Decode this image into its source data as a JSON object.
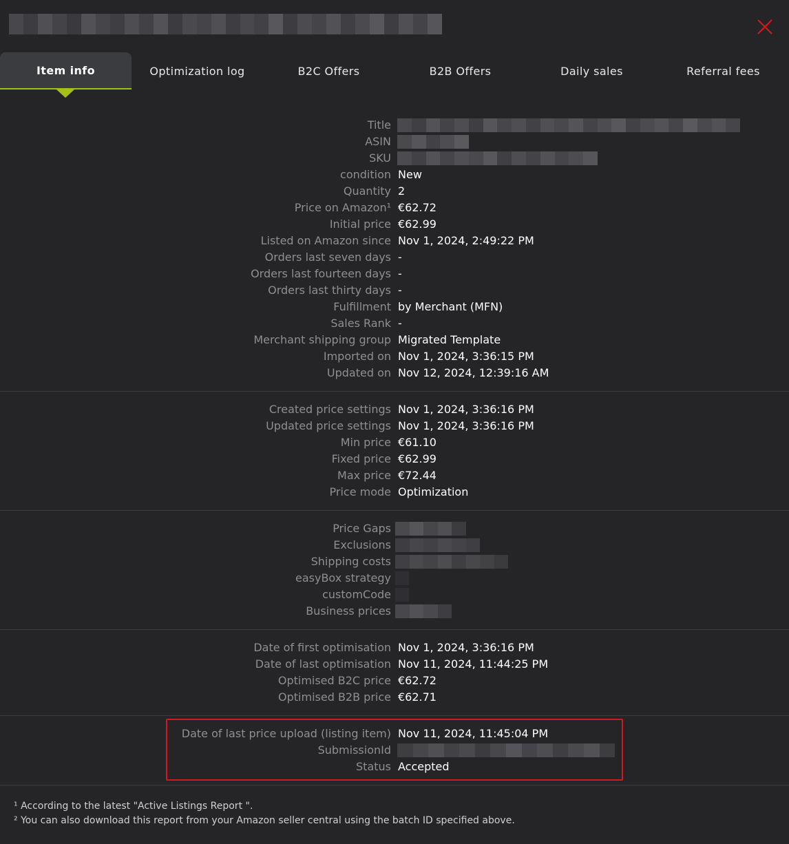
{
  "tabs": [
    {
      "label": "Item info",
      "active": true
    },
    {
      "label": "Optimization log"
    },
    {
      "label": "B2C Offers"
    },
    {
      "label": "B2B Offers"
    },
    {
      "label": "Daily sales"
    },
    {
      "label": "Referral fees"
    }
  ],
  "close_icon": "close-icon",
  "accent_color": "#a3c11b",
  "highlight_color": "#d6171e",
  "section1": {
    "title_label": "Title",
    "asin_label": "ASIN",
    "sku_label": "SKU",
    "condition_label": "condition",
    "condition": "New",
    "quantity_label": "Quantity",
    "quantity": "2",
    "price_on_amazon_label": "Price on Amazon¹",
    "price_on_amazon": "€62.72",
    "initial_price_label": "Initial price",
    "initial_price": "€62.99",
    "listed_since_label": "Listed on Amazon since",
    "listed_since": "Nov 1, 2024, 2:49:22 PM",
    "orders_7_label": "Orders last seven days",
    "orders_7": "-",
    "orders_14_label": "Orders last fourteen days",
    "orders_14": "-",
    "orders_30_label": "Orders last thirty days",
    "orders_30": "-",
    "fulfillment_label": "Fulfillment",
    "fulfillment": "by Merchant (MFN)",
    "sales_rank_label": "Sales Rank",
    "sales_rank": "-",
    "shipping_group_label": "Merchant shipping group",
    "shipping_group": "Migrated Template",
    "imported_on_label": "Imported on",
    "imported_on": "Nov 1, 2024, 3:36:15 PM",
    "updated_on_label": "Updated on",
    "updated_on": "Nov 12, 2024, 12:39:16 AM"
  },
  "section2": {
    "created_label": "Created price settings",
    "created": "Nov 1, 2024, 3:36:16 PM",
    "updated_label": "Updated price settings",
    "updated": "Nov 1, 2024, 3:36:16 PM",
    "min_label": "Min price",
    "min": "€61.10",
    "fixed_label": "Fixed price",
    "fixed": "€62.99",
    "max_label": "Max price",
    "max": "€72.44",
    "mode_label": "Price mode",
    "mode": "Optimization"
  },
  "section3": {
    "price_gaps_label": "Price Gaps",
    "exclusions_label": "Exclusions",
    "shipping_costs_label": "Shipping costs",
    "easybox_label": "easyBox strategy",
    "custom_code_label": "customCode",
    "business_prices_label": "Business prices"
  },
  "section4": {
    "first_opt_label": "Date of first optimisation",
    "first_opt": "Nov 1, 2024, 3:36:16 PM",
    "last_opt_label": "Date of last optimisation",
    "last_opt": "Nov 11, 2024, 11:44:25 PM",
    "b2c_label": "Optimised B2C price",
    "b2c": "€62.72",
    "b2b_label": "Optimised B2B price",
    "b2b": "€62.71"
  },
  "section5": {
    "last_upload_label": "Date of last price upload (listing item)",
    "last_upload": "Nov 11, 2024, 11:45:04 PM",
    "submission_label": "SubmissionId",
    "status_label": "Status",
    "status": "Accepted"
  },
  "footnotes": {
    "note1": "¹ According to the latest \"Active Listings Report \".",
    "note2": "² You can also download this report from your Amazon seller central using the batch ID specified above."
  }
}
